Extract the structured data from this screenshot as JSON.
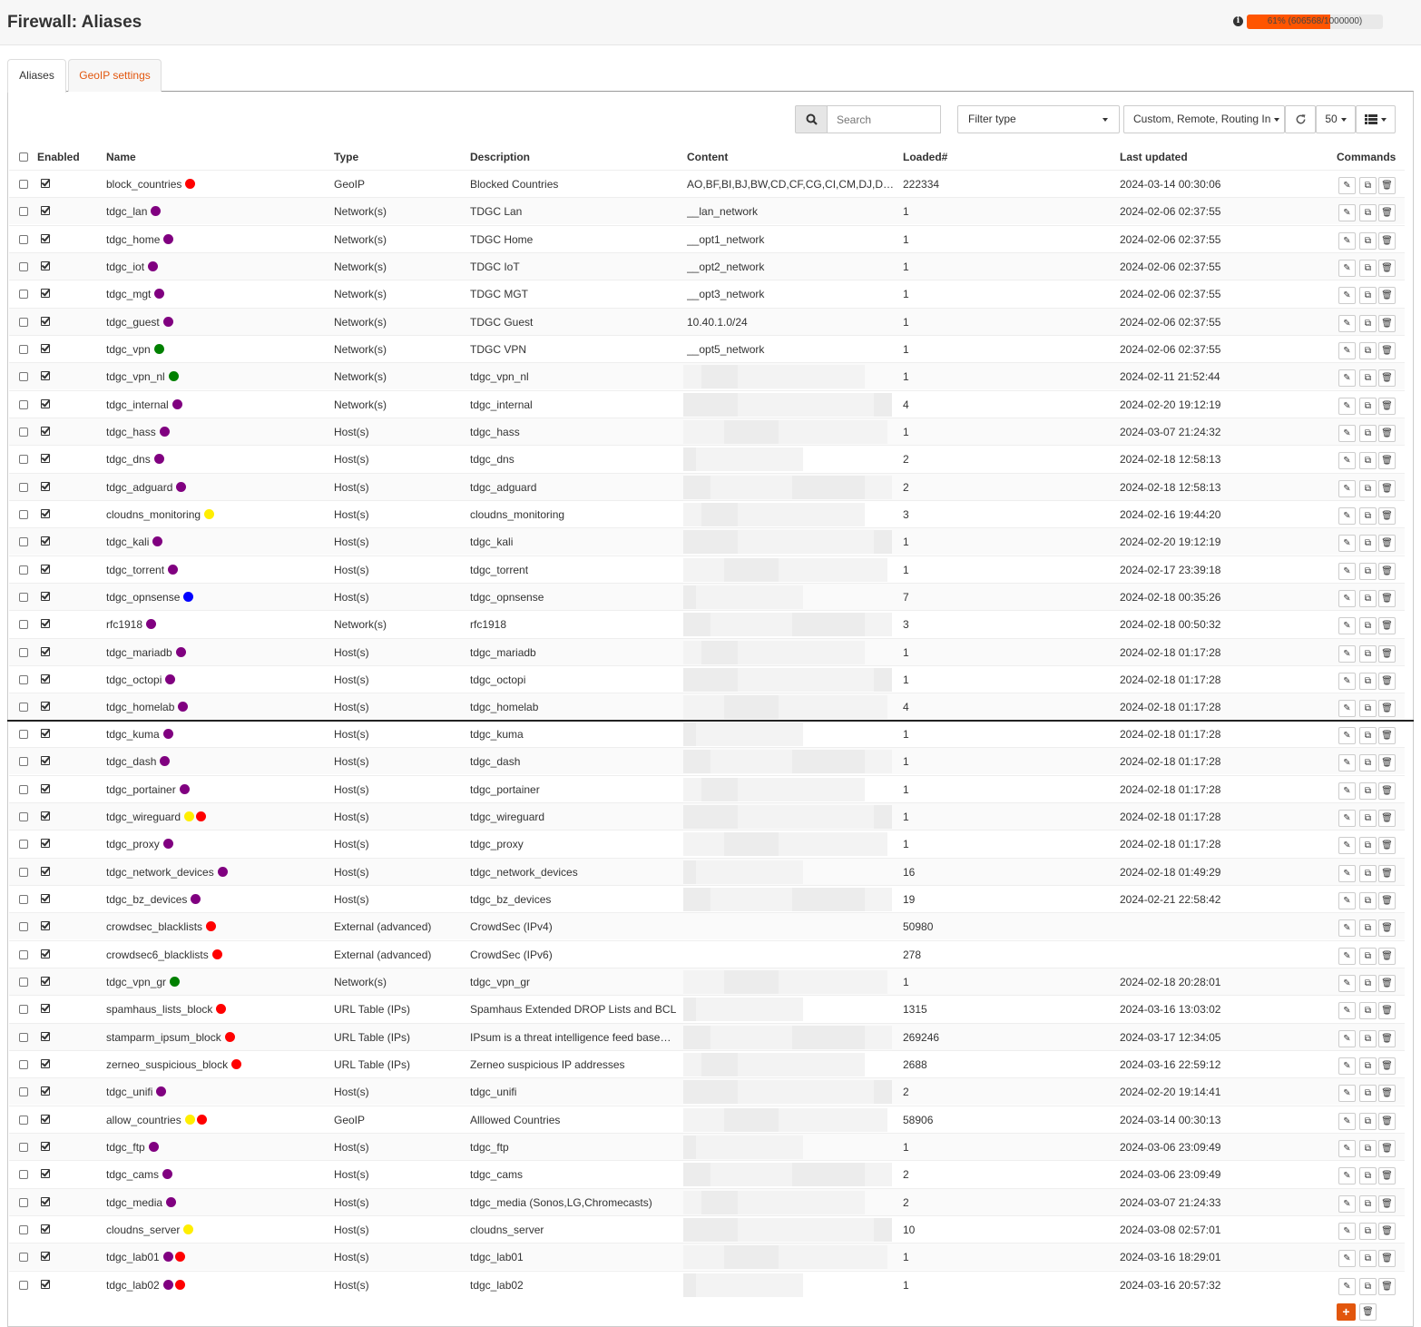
{
  "header": {
    "title": "Firewall: Aliases",
    "usage_text": "61% (606568/1000000)",
    "usage_fraction": 0.61
  },
  "tabs": [
    "Aliases",
    "GeoIP settings"
  ],
  "toolbar": {
    "search_placeholder": "Search",
    "filter_type": "Filter type",
    "category_filter": "Custom, Remote, Routing In",
    "page_size": "50"
  },
  "columns": [
    "Enabled",
    "Name",
    "Type",
    "Description",
    "Content",
    "Loaded#",
    "Last updated",
    "Commands"
  ],
  "colors": {
    "red": "#ff0000",
    "purple": "#800080",
    "green": "#008000",
    "blue": "#0000ff",
    "yellow": "#ffee00",
    "accent": "#e2560d"
  },
  "rows": [
    {
      "name": "block_countries",
      "dots": [
        "red"
      ],
      "type": "GeoIP",
      "description": "Blocked Countries",
      "content": "AO,BF,BI,BJ,BW,CD,CF,CG,CI,CM,DJ,DZ,EG...",
      "loaded": "222334",
      "updated": "2024-03-14 00:30:06",
      "redacted": false
    },
    {
      "name": "tdgc_lan",
      "dots": [
        "purple"
      ],
      "type": "Network(s)",
      "description": "TDGC Lan",
      "content": "__lan_network",
      "loaded": "1",
      "updated": "2024-02-06 02:37:55",
      "redacted": false
    },
    {
      "name": "tdgc_home",
      "dots": [
        "purple"
      ],
      "type": "Network(s)",
      "description": "TDGC Home",
      "content": "__opt1_network",
      "loaded": "1",
      "updated": "2024-02-06 02:37:55",
      "redacted": false
    },
    {
      "name": "tdgc_iot",
      "dots": [
        "purple"
      ],
      "type": "Network(s)",
      "description": "TDGC IoT",
      "content": "__opt2_network",
      "loaded": "1",
      "updated": "2024-02-06 02:37:55",
      "redacted": false
    },
    {
      "name": "tdgc_mgt",
      "dots": [
        "purple"
      ],
      "type": "Network(s)",
      "description": "TDGC MGT",
      "content": "__opt3_network",
      "loaded": "1",
      "updated": "2024-02-06 02:37:55",
      "redacted": false
    },
    {
      "name": "tdgc_guest",
      "dots": [
        "purple"
      ],
      "type": "Network(s)",
      "description": "TDGC Guest",
      "content": "10.40.1.0/24",
      "loaded": "1",
      "updated": "2024-02-06 02:37:55",
      "redacted": false
    },
    {
      "name": "tdgc_vpn",
      "dots": [
        "green"
      ],
      "type": "Network(s)",
      "description": "TDGC VPN",
      "content": "__opt5_network",
      "loaded": "1",
      "updated": "2024-02-06 02:37:55",
      "redacted": false
    },
    {
      "name": "tdgc_vpn_nl",
      "dots": [
        "green"
      ],
      "type": "Network(s)",
      "description": "tdgc_vpn_nl",
      "content": "",
      "loaded": "1",
      "updated": "2024-02-11 21:52:44",
      "redacted": true
    },
    {
      "name": "tdgc_internal",
      "dots": [
        "purple"
      ],
      "type": "Network(s)",
      "description": "tdgc_internal",
      "content": "",
      "loaded": "4",
      "updated": "2024-02-20 19:12:19",
      "redacted": true
    },
    {
      "name": "tdgc_hass",
      "dots": [
        "purple"
      ],
      "type": "Host(s)",
      "description": "tdgc_hass",
      "content": "",
      "loaded": "1",
      "updated": "2024-03-07 21:24:32",
      "redacted": true
    },
    {
      "name": "tdgc_dns",
      "dots": [
        "purple"
      ],
      "type": "Host(s)",
      "description": "tdgc_dns",
      "content": "",
      "loaded": "2",
      "updated": "2024-02-18 12:58:13",
      "redacted": true
    },
    {
      "name": "tdgc_adguard",
      "dots": [
        "purple"
      ],
      "type": "Host(s)",
      "description": "tdgc_adguard",
      "content": "",
      "loaded": "2",
      "updated": "2024-02-18 12:58:13",
      "redacted": true
    },
    {
      "name": "cloudns_monitoring",
      "dots": [
        "yellow"
      ],
      "type": "Host(s)",
      "description": "cloudns_monitoring",
      "content": "",
      "loaded": "3",
      "updated": "2024-02-16 19:44:20",
      "redacted": true
    },
    {
      "name": "tdgc_kali",
      "dots": [
        "purple"
      ],
      "type": "Host(s)",
      "description": "tdgc_kali",
      "content": "",
      "loaded": "1",
      "updated": "2024-02-20 19:12:19",
      "redacted": true
    },
    {
      "name": "tdgc_torrent",
      "dots": [
        "purple"
      ],
      "type": "Host(s)",
      "description": "tdgc_torrent",
      "content": "",
      "loaded": "1",
      "updated": "2024-02-17 23:39:18",
      "redacted": true
    },
    {
      "name": "tdgc_opnsense",
      "dots": [
        "blue"
      ],
      "type": "Host(s)",
      "description": "tdgc_opnsense",
      "content": "",
      "loaded": "7",
      "updated": "2024-02-18 00:35:26",
      "redacted": true
    },
    {
      "name": "rfc1918",
      "dots": [
        "purple"
      ],
      "type": "Network(s)",
      "description": "rfc1918",
      "content": "",
      "loaded": "3",
      "updated": "2024-02-18 00:50:32",
      "redacted": true
    },
    {
      "name": "tdgc_mariadb",
      "dots": [
        "purple"
      ],
      "type": "Host(s)",
      "description": "tdgc_mariadb",
      "content": "",
      "loaded": "1",
      "updated": "2024-02-18 01:17:28",
      "redacted": true
    },
    {
      "name": "tdgc_octopi",
      "dots": [
        "purple"
      ],
      "type": "Host(s)",
      "description": "tdgc_octopi",
      "content": "",
      "loaded": "1",
      "updated": "2024-02-18 01:17:28",
      "redacted": true
    },
    {
      "name": "tdgc_homelab",
      "dots": [
        "purple"
      ],
      "type": "Host(s)",
      "description": "tdgc_homelab",
      "content": "",
      "loaded": "4",
      "updated": "2024-02-18 01:17:28",
      "redacted": true
    },
    {
      "name": "tdgc_kuma",
      "dots": [
        "purple"
      ],
      "type": "Host(s)",
      "description": "tdgc_kuma",
      "content": "",
      "loaded": "1",
      "updated": "2024-02-18 01:17:28",
      "redacted": true
    },
    {
      "name": "tdgc_dash",
      "dots": [
        "purple"
      ],
      "type": "Host(s)",
      "description": "tdgc_dash",
      "content": "",
      "loaded": "1",
      "updated": "2024-02-18 01:17:28",
      "redacted": true
    },
    {
      "name": "tdgc_portainer",
      "dots": [
        "purple"
      ],
      "type": "Host(s)",
      "description": "tdgc_portainer",
      "content": "",
      "loaded": "1",
      "updated": "2024-02-18 01:17:28",
      "redacted": true
    },
    {
      "name": "tdgc_wireguard",
      "dots": [
        "yellow",
        "red"
      ],
      "type": "Host(s)",
      "description": "tdgc_wireguard",
      "content": "",
      "loaded": "1",
      "updated": "2024-02-18 01:17:28",
      "redacted": true
    },
    {
      "name": "tdgc_proxy",
      "dots": [
        "purple"
      ],
      "type": "Host(s)",
      "description": "tdgc_proxy",
      "content": "",
      "loaded": "1",
      "updated": "2024-02-18 01:17:28",
      "redacted": true
    },
    {
      "name": "tdgc_network_devices",
      "dots": [
        "purple"
      ],
      "type": "Host(s)",
      "description": "tdgc_network_devices",
      "content": "",
      "loaded": "16",
      "updated": "2024-02-18 01:49:29",
      "redacted": true
    },
    {
      "name": "tdgc_bz_devices",
      "dots": [
        "purple"
      ],
      "type": "Host(s)",
      "description": "tdgc_bz_devices",
      "content": "",
      "loaded": "19",
      "updated": "2024-02-21 22:58:42",
      "redacted": true
    },
    {
      "name": "crowdsec_blacklists",
      "dots": [
        "red"
      ],
      "type": "External (advanced)",
      "description": "CrowdSec (IPv4)",
      "content": "",
      "loaded": "50980",
      "updated": "",
      "redacted": false
    },
    {
      "name": "crowdsec6_blacklists",
      "dots": [
        "red"
      ],
      "type": "External (advanced)",
      "description": "CrowdSec (IPv6)",
      "content": "",
      "loaded": "278",
      "updated": "",
      "redacted": false
    },
    {
      "name": "tdgc_vpn_gr",
      "dots": [
        "green"
      ],
      "type": "Network(s)",
      "description": "tdgc_vpn_gr",
      "content": "",
      "loaded": "1",
      "updated": "2024-02-18 20:28:01",
      "redacted": true
    },
    {
      "name": "spamhaus_lists_block",
      "dots": [
        "red"
      ],
      "type": "URL Table (IPs)",
      "description": "Spamhaus Extended DROP Lists and BCL",
      "content": "",
      "loaded": "1315",
      "updated": "2024-03-16 13:03:02",
      "redacted": true
    },
    {
      "name": "stamparm_ipsum_block",
      "dots": [
        "red"
      ],
      "type": "URL Table (IPs)",
      "description": "IPsum is a threat intelligence feed based ...",
      "content": "",
      "loaded": "269246",
      "updated": "2024-03-17 12:34:05",
      "redacted": true
    },
    {
      "name": "zerneo_suspicious_block",
      "dots": [
        "red"
      ],
      "type": "URL Table (IPs)",
      "description": "Zerneo suspicious IP addresses",
      "content": "",
      "loaded": "2688",
      "updated": "2024-03-16 22:59:12",
      "redacted": true
    },
    {
      "name": "tdgc_unifi",
      "dots": [
        "purple"
      ],
      "type": "Host(s)",
      "description": "tdgc_unifi",
      "content": "",
      "loaded": "2",
      "updated": "2024-02-20 19:14:41",
      "redacted": true
    },
    {
      "name": "allow_countries",
      "dots": [
        "yellow",
        "red"
      ],
      "type": "GeoIP",
      "description": "Alllowed Countries",
      "content": "",
      "loaded": "58906",
      "updated": "2024-03-14 00:30:13",
      "redacted": true
    },
    {
      "name": "tdgc_ftp",
      "dots": [
        "purple"
      ],
      "type": "Host(s)",
      "description": "tdgc_ftp",
      "content": "",
      "loaded": "1",
      "updated": "2024-03-06 23:09:49",
      "redacted": true
    },
    {
      "name": "tdgc_cams",
      "dots": [
        "purple"
      ],
      "type": "Host(s)",
      "description": "tdgc_cams",
      "content": "",
      "loaded": "2",
      "updated": "2024-03-06 23:09:49",
      "redacted": true
    },
    {
      "name": "tdgc_media",
      "dots": [
        "purple"
      ],
      "type": "Host(s)",
      "description": "tdgc_media (Sonos,LG,Chromecasts)",
      "content": "",
      "loaded": "2",
      "updated": "2024-03-07 21:24:33",
      "redacted": true
    },
    {
      "name": "cloudns_server",
      "dots": [
        "yellow"
      ],
      "type": "Host(s)",
      "description": "cloudns_server",
      "content": "",
      "loaded": "10",
      "updated": "2024-03-08 02:57:01",
      "redacted": true
    },
    {
      "name": "tdgc_lab01",
      "dots": [
        "purple",
        "red"
      ],
      "type": "Host(s)",
      "description": "tdgc_lab01",
      "content": "",
      "loaded": "1",
      "updated": "2024-03-16 18:29:01",
      "redacted": true
    },
    {
      "name": "tdgc_lab02",
      "dots": [
        "purple",
        "red"
      ],
      "type": "Host(s)",
      "description": "tdgc_lab02",
      "content": "",
      "loaded": "1",
      "updated": "2024-03-16 20:57:32",
      "redacted": true
    }
  ]
}
